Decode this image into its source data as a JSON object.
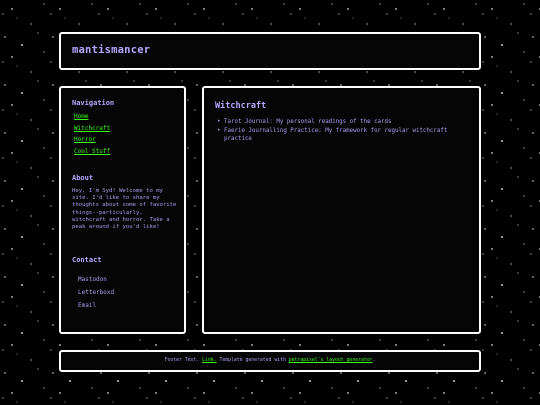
{
  "header": {
    "title": "mantismancer"
  },
  "sidebar": {
    "navigation": {
      "heading": "Navigation",
      "items": [
        "Home",
        "Witchcraft",
        "Horror",
        "Cool Stuff"
      ]
    },
    "about": {
      "heading": "About",
      "text": "Hey, I'm Syd! Welcome to my site. I'd like to share my thoughts about some of favorite things--particularly, witchcraft and horror. Take a peak around if you'd like!"
    },
    "contact": {
      "heading": "Contact",
      "items": [
        "Mastodon",
        "Letterboxd",
        "Email"
      ]
    }
  },
  "main": {
    "heading": "Witchcraft",
    "items": [
      "Tarot Journal: My personal readings of the cards",
      "Faerie Journalling Practice: My framework for regular witchcraft practice"
    ]
  },
  "footer": {
    "prefix": "Footer Text.",
    "link1": "Link.",
    "middle": "Template generated with",
    "link2": "petrapixel's layout generator",
    "suffix": "."
  },
  "colors": {
    "background": "#000000",
    "panel_border": "#ffffff",
    "text": "#a99ef0",
    "heading": "#b4a8ff",
    "link": "#39ff14"
  }
}
